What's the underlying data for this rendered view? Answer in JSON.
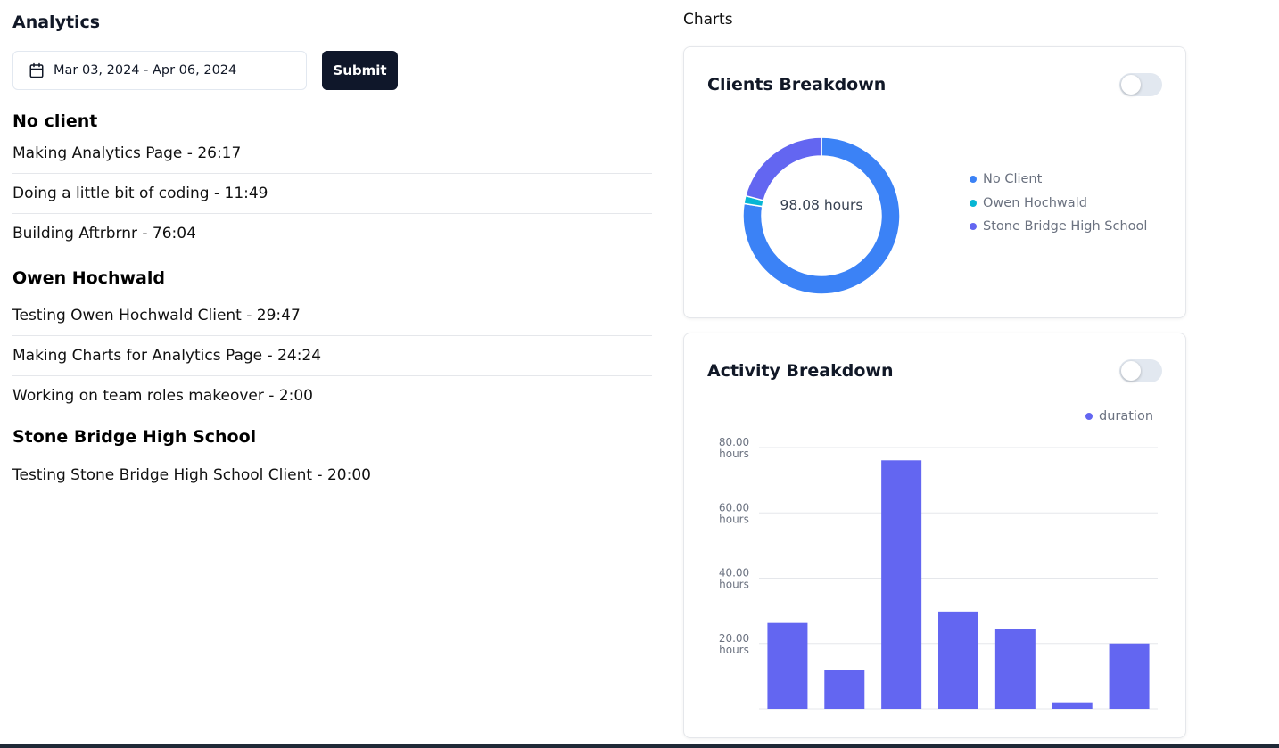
{
  "page_title": "Analytics",
  "date_range": {
    "value": "Mar 03, 2024 - Apr 06, 2024",
    "icon": "calendar-icon"
  },
  "submit_label": "Submit",
  "groups": [
    {
      "name": "No client",
      "entries": [
        "Making Analytics Page - 26:17",
        "Doing a little bit of coding - 11:49",
        "Building Aftrbrnr - 76:04"
      ]
    },
    {
      "name": "Owen Hochwald",
      "entries": [
        "Testing Owen Hochwald Client - 29:47",
        "Making Charts for Analytics Page - 24:24",
        "Working on team roles makeover - 2:00"
      ]
    },
    {
      "name": "Stone Bridge High School",
      "entries": [
        "Testing Stone Bridge High School Client - 20:00"
      ]
    }
  ],
  "charts_label": "Charts",
  "clients_card": {
    "title": "Clients Breakdown",
    "toggle_on": false,
    "center_label": "98.08 hours"
  },
  "activity_card": {
    "title": "Activity Breakdown",
    "toggle_on": false
  },
  "colors": {
    "no_client": "#3b82f6",
    "owen": "#06b6d4",
    "stone": "#6366f1",
    "bar": "#6366f1",
    "primary_button": "#0f172a"
  },
  "chart_data": [
    {
      "type": "pie",
      "variant": "donut",
      "center_label": "98.08 hours",
      "categories": [
        "No Client",
        "Owen Hochwald",
        "Stone Bridge High School"
      ],
      "values": [
        76.0,
        1.6,
        20.5
      ],
      "colors": [
        "#3b82f6",
        "#06b6d4",
        "#6366f1"
      ],
      "legend_position": "right"
    },
    {
      "type": "bar",
      "series": [
        {
          "name": "duration",
          "values": [
            26.3,
            11.8,
            76.1,
            29.8,
            24.4,
            2.0,
            20.0
          ],
          "color": "#6366f1"
        }
      ],
      "y_ticks": [
        "20.00 hours",
        "40.00 hours",
        "60.00 hours",
        "80.00 hours"
      ],
      "ylim": [
        0,
        80
      ],
      "grid": true,
      "legend_position": "top-right"
    }
  ]
}
